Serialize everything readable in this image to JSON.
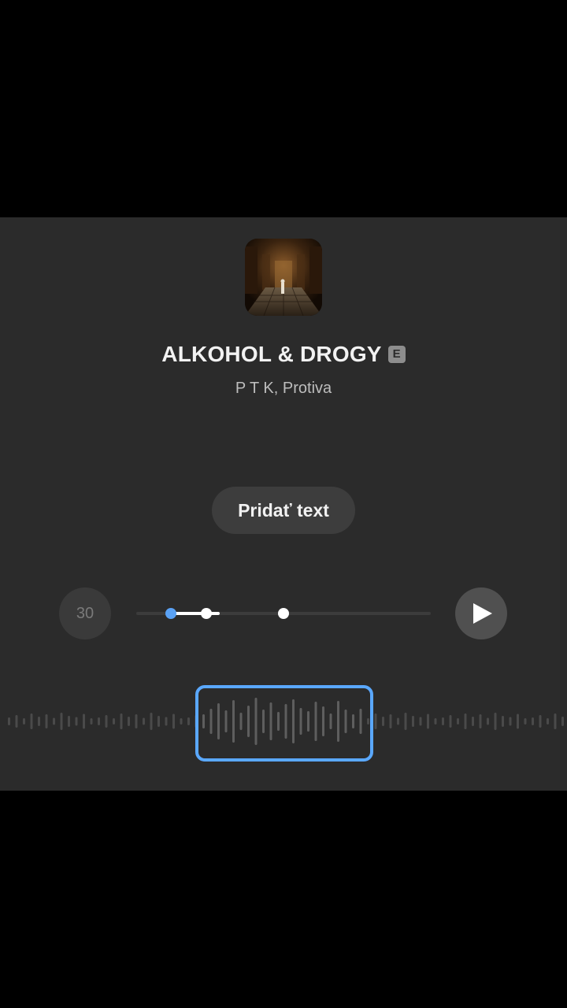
{
  "song": {
    "title": "ALKOHOL & DROGY",
    "explicit_badge": "E",
    "artists": "P T K, Protiva"
  },
  "add_text_button": {
    "label": "Pridať text"
  },
  "duration_button": {
    "label": "30"
  },
  "playback": {
    "state": "paused",
    "play_icon": "play-icon"
  },
  "colors": {
    "panel_background": "#2b2b2b",
    "accent_blue": "#5aa8ff",
    "text_primary": "#f2f2f2",
    "text_secondary": "#bdbdbd"
  },
  "icons": [
    "album-cover",
    "explicit-badge",
    "play-icon"
  ]
}
